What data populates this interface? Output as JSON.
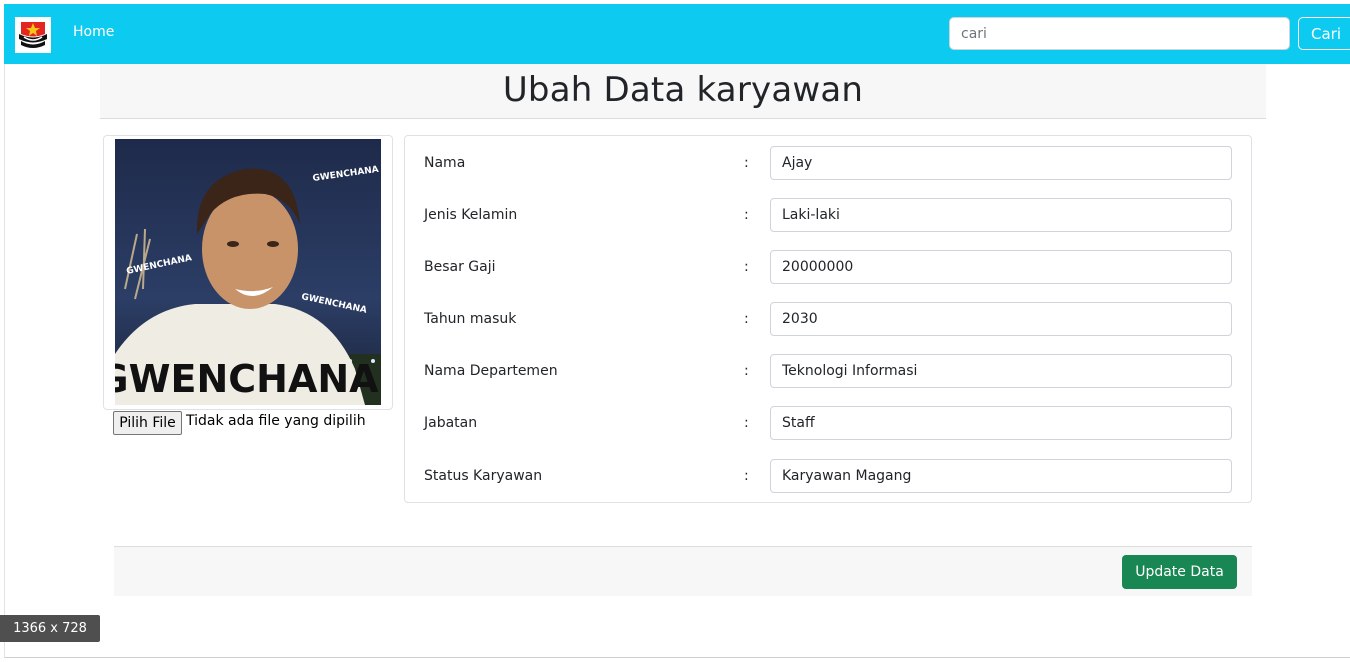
{
  "navbar": {
    "home_label": "Home",
    "search": {
      "placeholder": "cari",
      "value": ""
    },
    "search_button_label": "Cari",
    "background_color": "#0dcaf0"
  },
  "page": {
    "title": "Ubah Data karyawan"
  },
  "photo": {
    "caption_big": "GWENCHANA",
    "caption_small": "GWENCHANA"
  },
  "file_input": {
    "button_label": "Pilih File",
    "status": "Tidak ada file yang dipilih"
  },
  "form": {
    "colon": ":",
    "fields": [
      {
        "label": "Nama",
        "value": "Ajay"
      },
      {
        "label": "Jenis Kelamin",
        "value": "Laki-laki"
      },
      {
        "label": "Besar Gaji",
        "value": "20000000"
      },
      {
        "label": "Tahun masuk",
        "value": "2030"
      },
      {
        "label": "Nama Departemen",
        "value": "Teknologi Informasi"
      },
      {
        "label": "Jabatan",
        "value": "Staff"
      },
      {
        "label": "Status Karyawan",
        "value": "Karyawan Magang"
      }
    ]
  },
  "footer": {
    "update_label": "Update Data",
    "button_color": "#198754"
  },
  "viewport_badge": "1366 x 728"
}
